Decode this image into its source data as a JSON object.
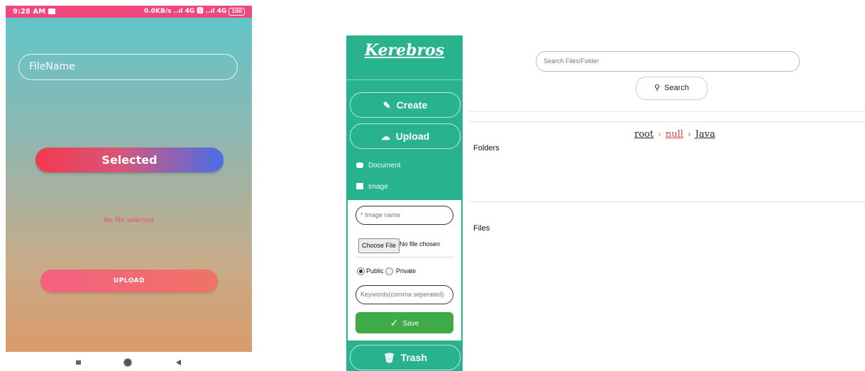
{
  "phone": {
    "status": {
      "time": "9:28 AM",
      "right": "0.0KB/s ..ıl 4G 🅱 ..ıl 4G",
      "battery": "100"
    },
    "filename_placeholder": "FileName",
    "selected_label": "Selected",
    "no_file_text": "No file selected",
    "upload_label": "UPLOAD",
    "colors": {
      "status_bar": "#f2477d",
      "bg_top": "#5ec7c9",
      "bg_bottom": "#d99b6b"
    }
  },
  "web": {
    "brand": "Kerebros",
    "sidebar": {
      "create_label": "Create",
      "upload_label": "Upload",
      "document_label": "Document",
      "image_label": "Image",
      "trash_label": "Trash"
    },
    "form": {
      "image_name_placeholder": "* Image name",
      "choose_file_label": "Choose File",
      "no_file_chosen": "No file chosen",
      "public_label": "Public",
      "private_label": "Private",
      "keywords_placeholder": "Keywords(comma seperated)",
      "save_label": "Save"
    },
    "search": {
      "placeholder": "Search Files/Folder",
      "button_label": "Search"
    },
    "breadcrumb": [
      {
        "label": "root"
      },
      {
        "label": "null"
      },
      {
        "label": "Java"
      }
    ],
    "folders_label": "Folders",
    "files_label": "Files",
    "colors": {
      "sidebar": "#28b38e",
      "save": "#3faa48",
      "breadcrumb_active": "#e53935"
    }
  }
}
